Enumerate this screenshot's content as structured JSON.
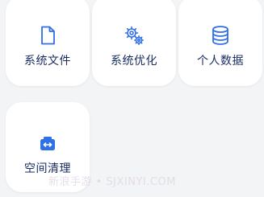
{
  "colors": {
    "accent": "#2f6fe8",
    "label": "#1a2c63",
    "background": "#f3f4f6",
    "card": "#ffffff"
  },
  "tiles": [
    {
      "label": "系统文件",
      "icon": "document-icon"
    },
    {
      "label": "系统优化",
      "icon": "gears-icon"
    },
    {
      "label": "个人数据",
      "icon": "database-icon"
    },
    {
      "label": "空间清理",
      "icon": "storage-clean-icon"
    }
  ],
  "watermark": "新浪手游 • SJXINYI.COM"
}
